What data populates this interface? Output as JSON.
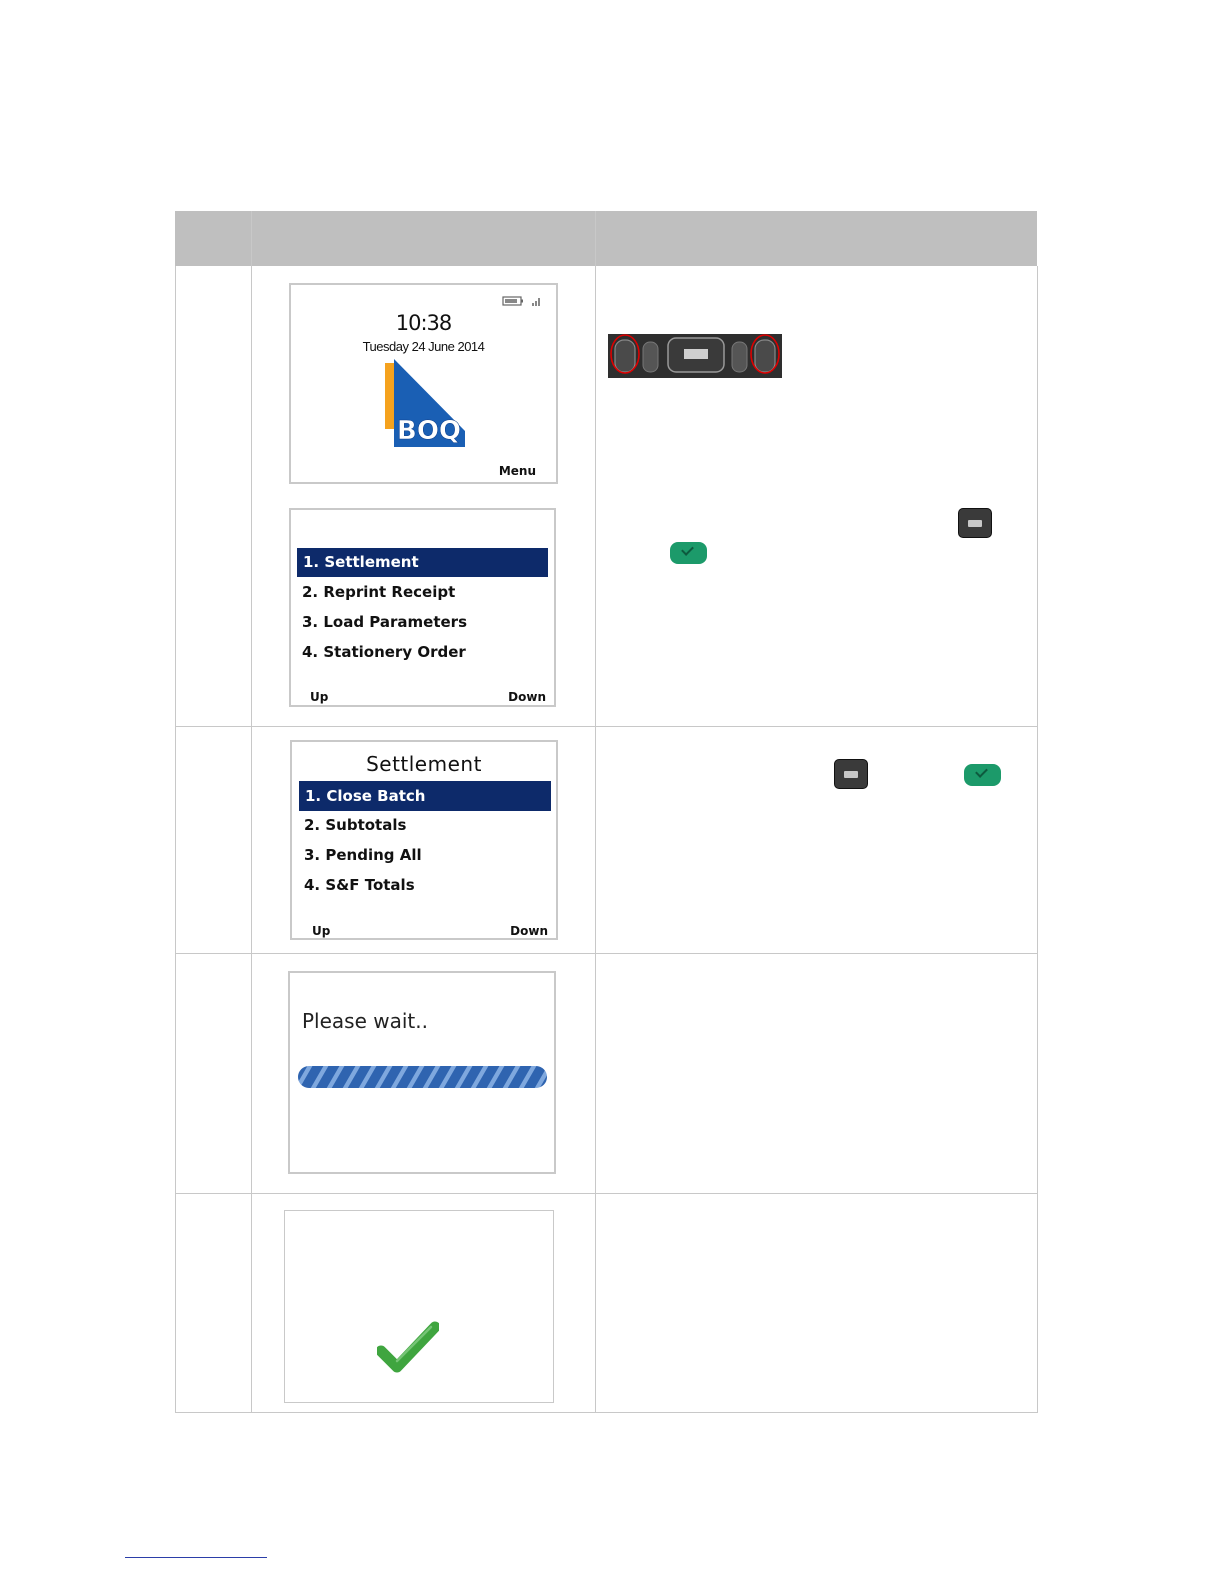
{
  "colors": {
    "header_bg": "#bfbfbf",
    "selection_bg": "#0d2a6a",
    "brand_blue": "#1a5fb4",
    "brand_orange": "#f5a21e",
    "confirm_green": "#1c9a6a",
    "tick_green": "#3fa53f"
  },
  "screen1": {
    "time": "10:38",
    "date": "Tuesday 24 June 2014",
    "logo_text": "BOQ",
    "softkey_right": "Menu"
  },
  "screen2": {
    "items": [
      "1. Settlement",
      "2. Reprint Receipt",
      "3. Load Parameters",
      "4. Stationery Order"
    ],
    "selected_index": 0,
    "softkey_left": "Up",
    "softkey_right": "Down"
  },
  "screen3": {
    "title": "Settlement",
    "items": [
      "1. Close Batch",
      "2. Subtotals",
      "3. Pending All",
      "4. S&F Totals"
    ],
    "selected_index": 0,
    "softkey_left": "Up",
    "softkey_right": "Down"
  },
  "screen4": {
    "message": "Please wait..",
    "progress": 1.0
  },
  "screen5": {
    "icon": "check-icon"
  },
  "keys": {
    "keypad_icon": "keypad-strip-icon",
    "enter_key_icon": "enter-key-icon",
    "confirm_key_icon": "green-confirm-key-icon"
  }
}
